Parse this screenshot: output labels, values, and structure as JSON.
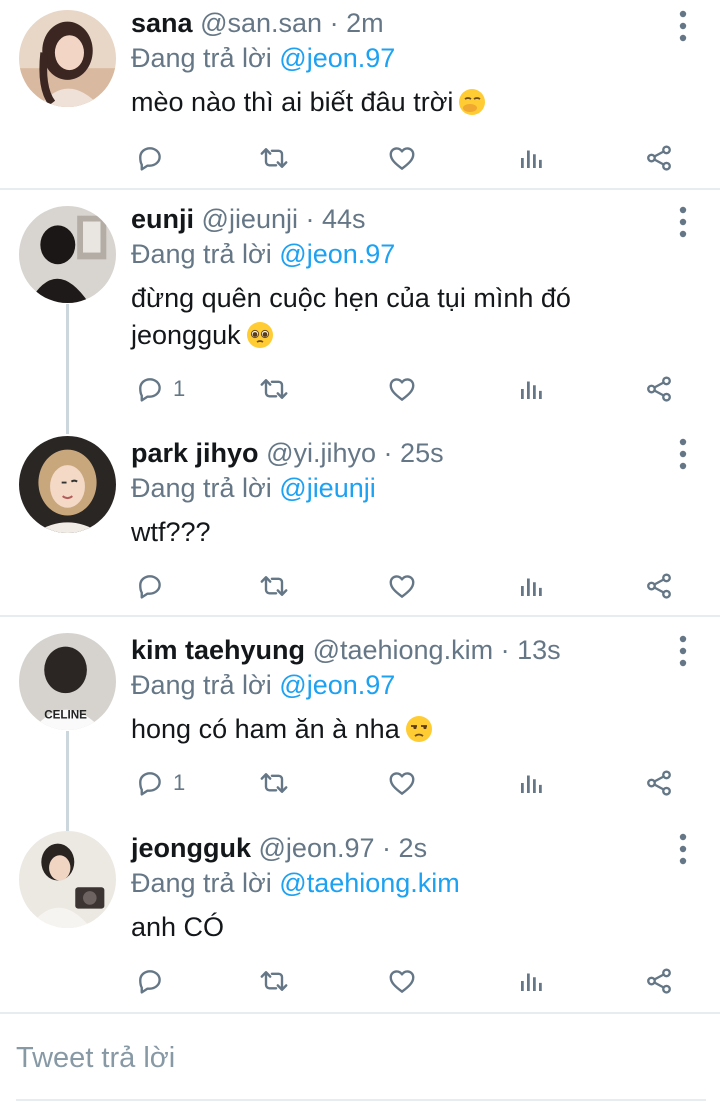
{
  "replying_prefix": "Đang trả lời",
  "tweets": [
    {
      "name": "sana",
      "handle": "@san.san",
      "separator": "·",
      "time": "2m",
      "reply_to": "@jeon.97",
      "text": "mèo nào thì ai biết đâu trời",
      "emoji": "face-with-hand-over-mouth",
      "reply_count": ""
    },
    {
      "name": "eunji",
      "handle": "@jieunji",
      "separator": "·",
      "time": "44s",
      "reply_to": "@jeon.97",
      "text": "đừng quên cuộc hẹn của tụi mình đó jeongguk",
      "emoji": "pleading-face",
      "reply_count": "1"
    },
    {
      "name": "park jihyo",
      "handle": "@yi.jihyo",
      "separator": "·",
      "time": "25s",
      "reply_to": "@jieunji",
      "text": "wtf???",
      "emoji": "",
      "reply_count": ""
    },
    {
      "name": "kim taehyung",
      "handle": "@taehiong.kim",
      "separator": "·",
      "time": "13s",
      "reply_to": "@jeon.97",
      "text": "hong có ham ăn à nha",
      "emoji": "unamused-face",
      "reply_count": "1"
    },
    {
      "name": "jeongguk",
      "handle": "@jeon.97",
      "separator": "·",
      "time": "2s",
      "reply_to": "@taehiong.kim",
      "text": "anh CÓ",
      "emoji": "",
      "reply_count": ""
    }
  ],
  "reply_box": {
    "placeholder": "Tweet trả lời"
  },
  "colors": {
    "link": "#1da1f2",
    "secondary_text": "#657786",
    "icon": "#657786",
    "divider": "#e6ecf0",
    "thread_line": "#ccd6dd"
  },
  "icons": {
    "reply": "reply-icon",
    "retweet": "retweet-icon",
    "like": "heart-icon",
    "analytics": "analytics-icon",
    "share": "share-icon",
    "more": "more-vertical-icon"
  }
}
